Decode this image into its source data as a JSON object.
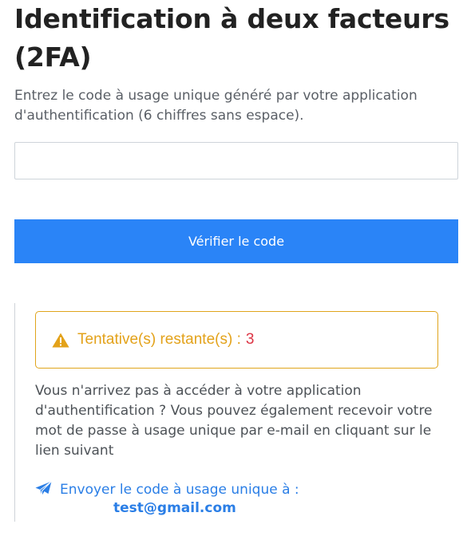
{
  "page": {
    "title": "Identification à deux facteurs (2FA)",
    "subtitle": "Entrez le code à usage unique généré par votre application d'authentification (6 chiffres sans espace)."
  },
  "form": {
    "code_value": "",
    "code_placeholder": "",
    "verify_label": "Vérifier le code"
  },
  "alert": {
    "icon": "warning-triangle-icon",
    "label": "Tentative(s) restante(s) :",
    "count": "3",
    "colors": {
      "border": "#e0a51c",
      "text": "#e3a21a",
      "count": "#dc3545"
    }
  },
  "help": {
    "text": "Vous n'arrivez pas à accéder à votre application d'authentification ? Vous pouvez également recevoir votre mot de passe à usage unique par e-mail en cliquant sur le lien suivant",
    "link_icon": "paper-plane-icon",
    "link_label": "Envoyer le code à usage unique à :",
    "email": "test@gmail.com"
  },
  "colors": {
    "primary": "#2a84f7",
    "link": "#2a7ee6"
  }
}
